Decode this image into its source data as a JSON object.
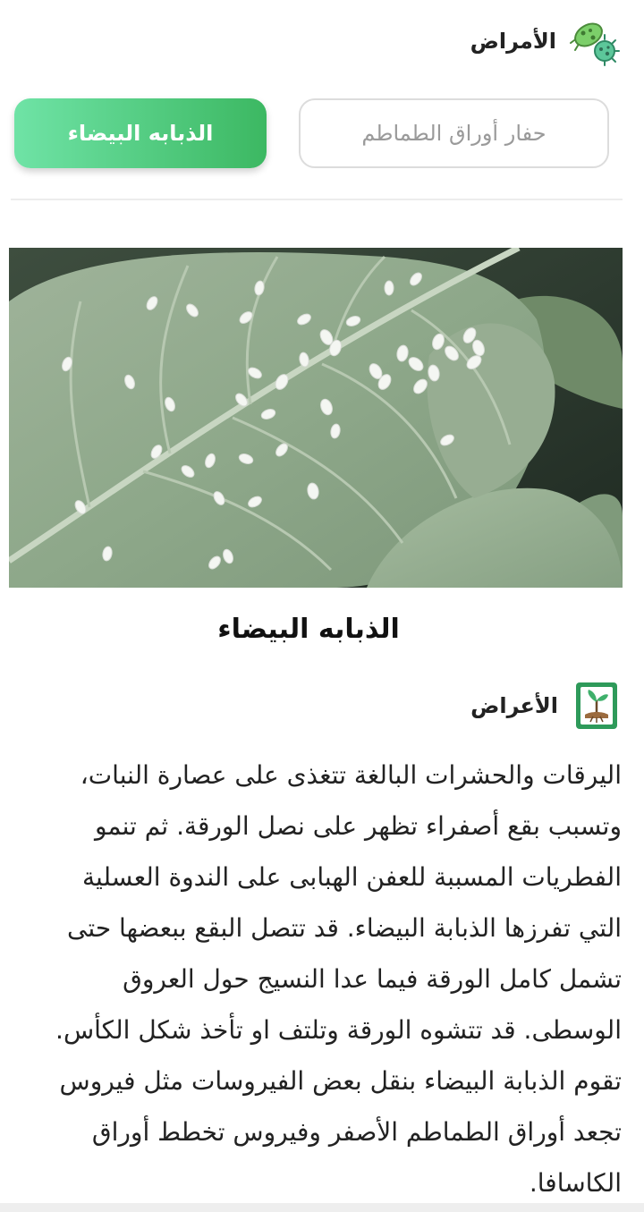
{
  "header": {
    "title": "الأمراض",
    "icon": "bacteria-icon"
  },
  "tabs": [
    {
      "label": "حفار أوراق الطماطم",
      "active": false
    },
    {
      "label": "الذبابه البيضاء",
      "active": true
    }
  ],
  "colors": {
    "accent_start": "#6fe3a6",
    "accent_end": "#3cb862",
    "icon_green": "#2e8b57"
  },
  "hero": {
    "image": "whitefly-on-tomato-leaf"
  },
  "disease": {
    "title": "الذبابه البيضاء"
  },
  "section": {
    "title": "الأعراض",
    "icon": "plant-book-icon",
    "lines": [
      "اليرقات والحشرات البالغة تتغذى على عصارة النبات،",
      "وتسبب بقع أصفراء تظهر على نصل الورقة. ثم تنمو",
      "الفطريات المسببة للعفن الهبابى على الندوة العسلية",
      "التي تفرزها الذبابة البيضاء. قد تتصل البقع ببعضها حتى",
      "تشمل كامل الورقة فيما عدا النسيج حول العروق",
      "الوسطى. قد تتشوه الورقة وتلتف او تأخذ شكل الكأس.",
      "تقوم الذبابة البيضاء بنقل بعض الفيروسات مثل فيروس",
      "تجعد أوراق الطماطم الأصفر وفيروس تخطط أوراق",
      "الكاسافا."
    ]
  }
}
